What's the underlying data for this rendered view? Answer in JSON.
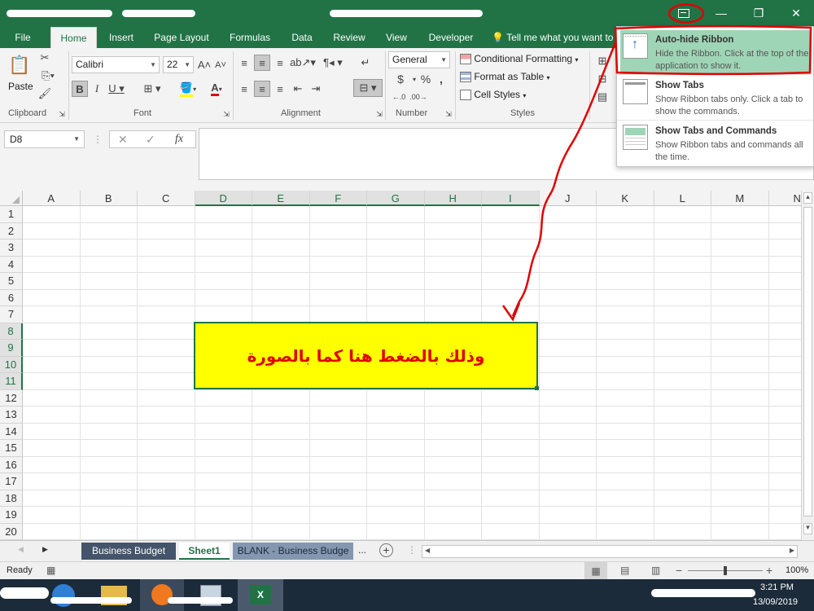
{
  "titlebar": {
    "ribbon_options_icon": "ribbon-display-options-icon",
    "minimize": "—",
    "restore": "❐",
    "close": "✕"
  },
  "tabs": [
    {
      "label": "File"
    },
    {
      "label": "Home"
    },
    {
      "label": "Insert"
    },
    {
      "label": "Page Layout"
    },
    {
      "label": "Formulas"
    },
    {
      "label": "Data"
    },
    {
      "label": "Review"
    },
    {
      "label": "View"
    },
    {
      "label": "Developer"
    }
  ],
  "tell_me": "Tell me what you want to",
  "ribbon": {
    "paste_label": "Paste",
    "font_name": "Calibri",
    "font_size": "22",
    "number_format": "General",
    "groups": {
      "clipboard": "Clipboard",
      "font": "Font",
      "alignment": "Alignment",
      "number": "Number",
      "styles": "Styles"
    },
    "styles": {
      "conditional": "Conditional Formatting",
      "format_table": "Format as Table",
      "cell_styles": "Cell Styles"
    },
    "number_symbols": {
      "currency": "$",
      "percent": "%",
      "comma": ","
    }
  },
  "formula_bar": {
    "name_box": "D8",
    "cancel": "✕",
    "enter": "✓",
    "fx": "fx"
  },
  "grid": {
    "columns": [
      "A",
      "B",
      "C",
      "D",
      "E",
      "F",
      "G",
      "H",
      "I",
      "J",
      "K",
      "L",
      "M",
      "N"
    ],
    "rows": [
      "1",
      "2",
      "3",
      "4",
      "5",
      "6",
      "7",
      "8",
      "9",
      "10",
      "11",
      "12",
      "13",
      "14",
      "15",
      "16",
      "17",
      "18",
      "19",
      "20"
    ],
    "selected_column_range": [
      "D",
      "I"
    ],
    "selected_row_range": [
      "8",
      "11"
    ]
  },
  "annotation": {
    "text": "وذلك بالضغط هنا كما بالصورة"
  },
  "sheets": [
    {
      "label": "Business Budget"
    },
    {
      "label": "Sheet1"
    },
    {
      "label": "BLANK - Business Budge"
    }
  ],
  "sheet_more": "...",
  "status": {
    "ready": "Ready",
    "zoom": "100%",
    "zoom_minus": "−",
    "zoom_plus": "+"
  },
  "taskbar": {
    "time": "3:21 PM",
    "date": "13/09/2019"
  },
  "dropdown": {
    "options": [
      {
        "title": "Auto-hide Ribbon",
        "desc": "Hide the Ribbon. Click at the top of the application to show it."
      },
      {
        "title": "Show Tabs",
        "desc": "Show Ribbon tabs only. Click a tab to show the commands."
      },
      {
        "title": "Show Tabs and Commands",
        "desc": "Show Ribbon tabs and commands all the time."
      }
    ]
  },
  "colors": {
    "excel_green": "#217346",
    "annotation_red": "#e00000",
    "highlight_yellow": "#ffff00",
    "option_highlight": "#9fd5b7"
  }
}
